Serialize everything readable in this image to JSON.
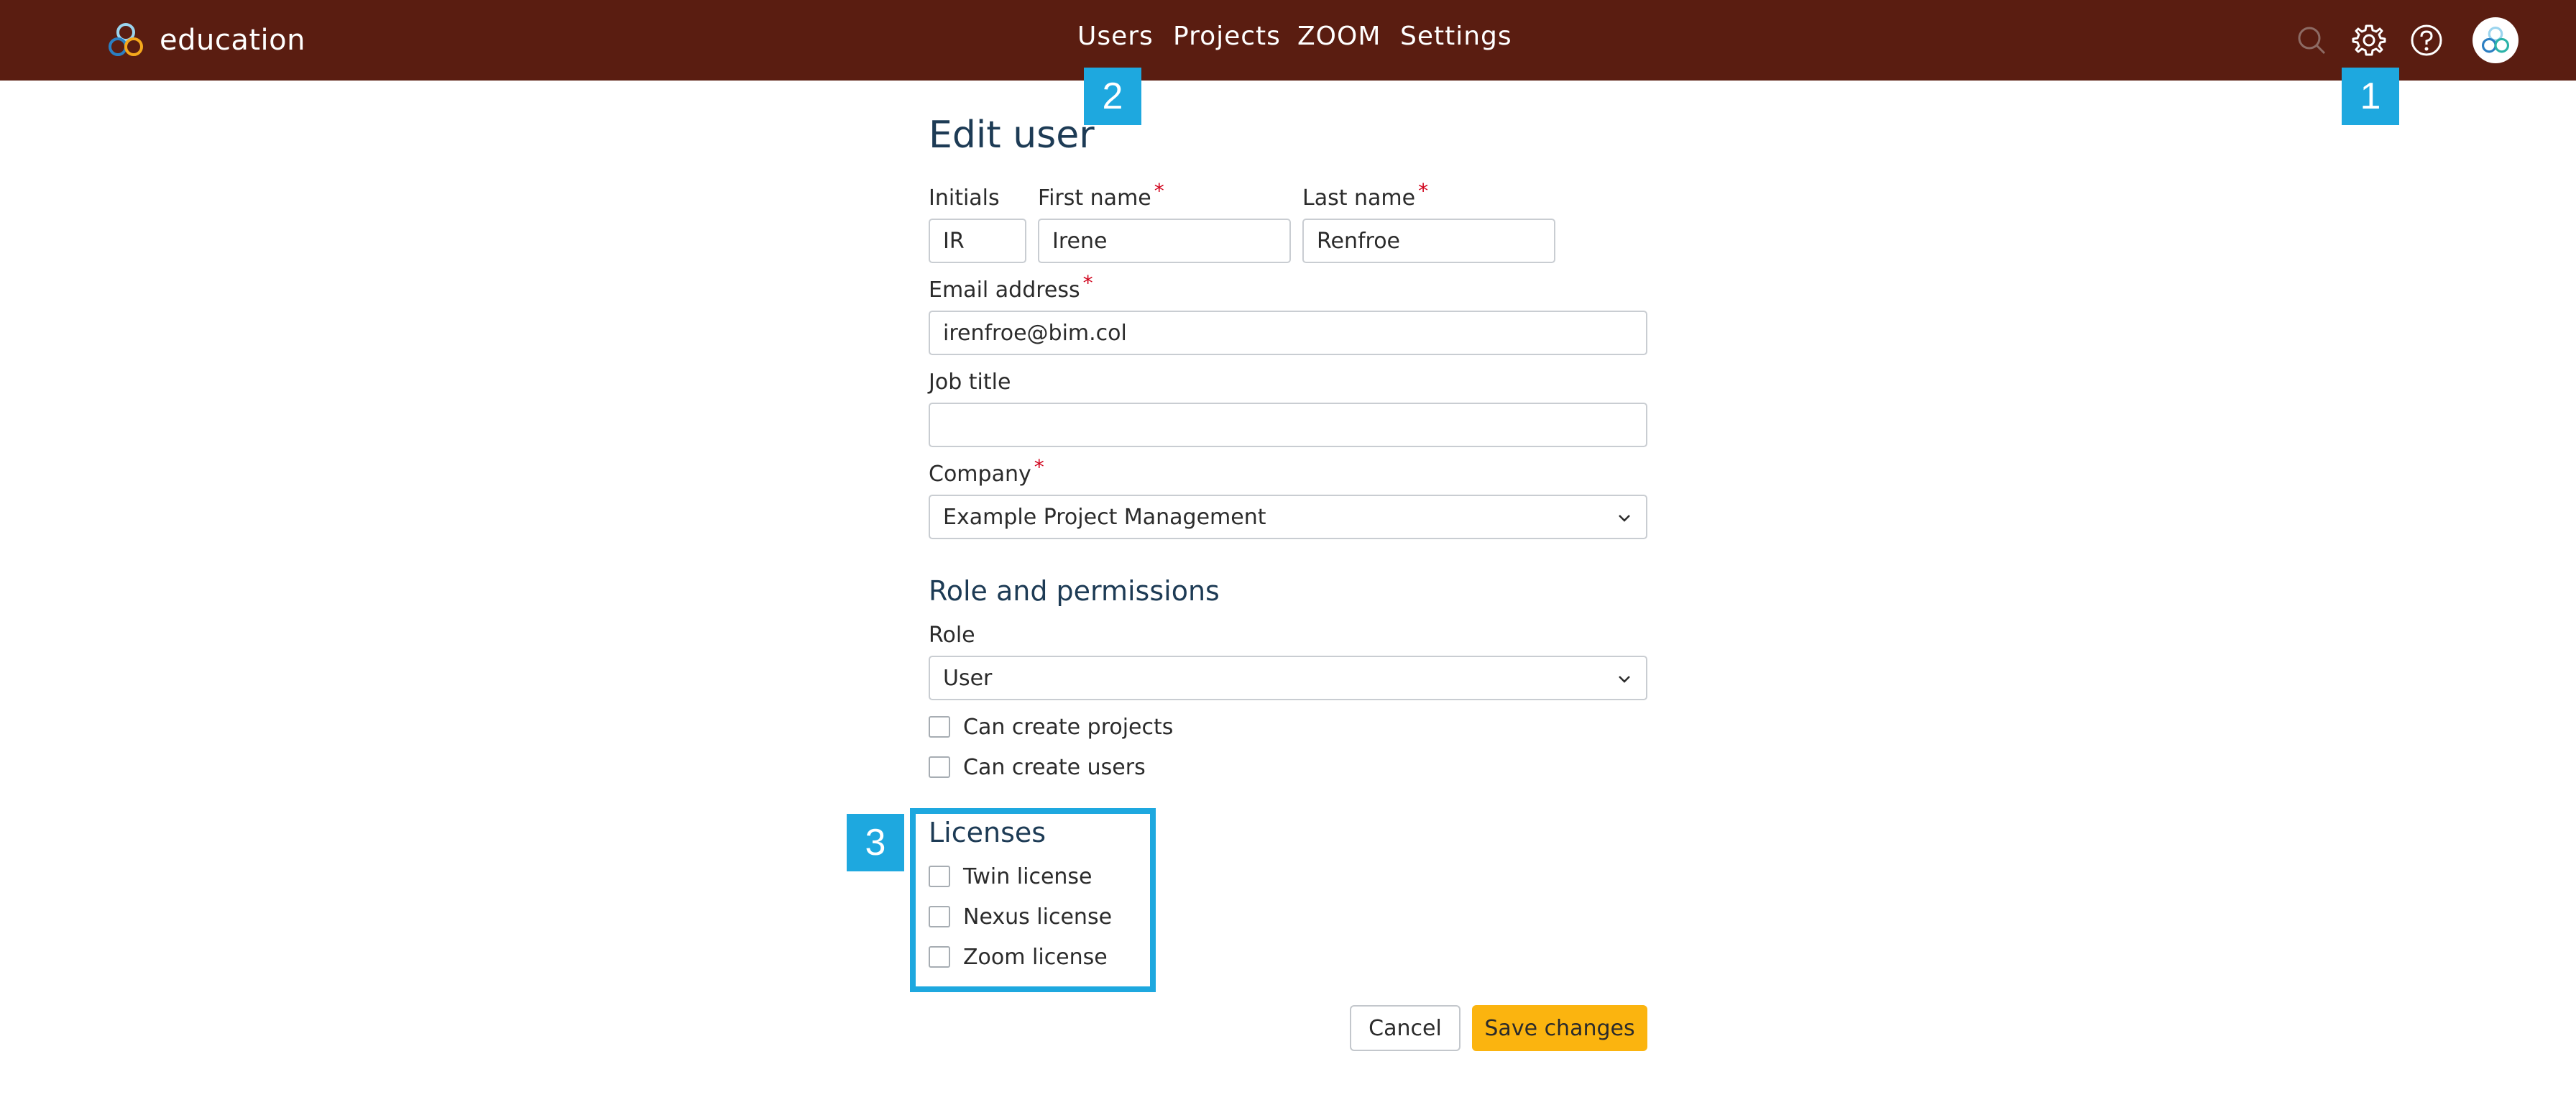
{
  "header": {
    "brand": "education",
    "nav": [
      "Users",
      "Projects",
      "ZOOM",
      "Settings"
    ],
    "icons": [
      "search-icon",
      "gear-icon",
      "help-icon",
      "avatar"
    ]
  },
  "markers": {
    "one": "1",
    "two": "2",
    "three": "3"
  },
  "form": {
    "title": "Edit user",
    "initials": {
      "label": "Initials",
      "value": "IR"
    },
    "first_name": {
      "label": "First name",
      "value": "Irene"
    },
    "last_name": {
      "label": "Last name",
      "value": "Renfroe"
    },
    "email": {
      "label": "Email address",
      "value": "irenfroe@bim.col"
    },
    "job_title": {
      "label": "Job title",
      "value": ""
    },
    "company": {
      "label": "Company",
      "value": "Example Project Management"
    },
    "required_mark": "*"
  },
  "permissions": {
    "title": "Role and permissions",
    "role_label": "Role",
    "role_value": "User",
    "checks": [
      "Can create projects",
      "Can create users"
    ]
  },
  "licenses": {
    "title": "Licenses",
    "checks": [
      "Twin license",
      "Nexus license",
      "Zoom license"
    ]
  },
  "actions": {
    "cancel": "Cancel",
    "save": "Save changes"
  },
  "colors": {
    "topbar": "#5a1d11",
    "accent": "#1ea8df",
    "save": "#fbb40f",
    "required": "#d0021b"
  }
}
